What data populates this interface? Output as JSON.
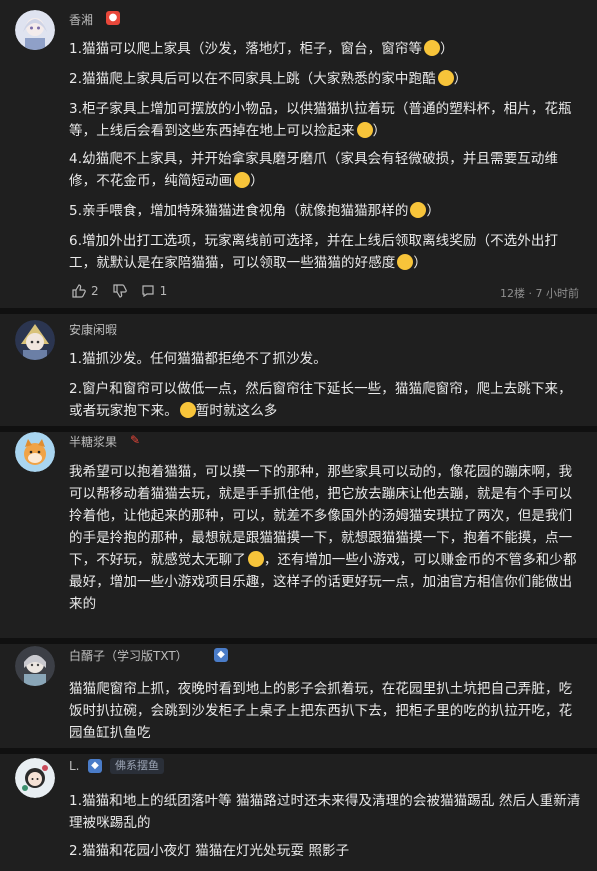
{
  "comments": [
    {
      "username": "香湘",
      "paragraphs": [
        "1.猫猫可以爬上家具（沙发，落地灯，柜子，窗台，窗帘等",
        "2.猫猫爬上家具后可以在不同家具上跳（大家熟悉的家中跑酷",
        "3.柜子家具上增加可摆放的小物品，以供猫猫扒拉着玩（普通的塑料杯，相片，花瓶等，上线后会看到这些东西掉在地上可以捡起来",
        "4.幼猫爬不上家具，并开始拿家具磨牙磨爪（家具会有轻微破损，并且需要互动维修，不花金币，纯简短动画",
        "5.亲手喂食，增加特殊猫猫进食视角（就像抱猫猫那样的",
        "6.增加外出打工选项，玩家离线前可选择，并在上线后领取离线奖励（不选外出打工，就默认是在家陪猫猫，可以领取一些猫猫的好感度"
      ],
      "paragraph_suffix": [
        "）",
        "）",
        "）",
        "）",
        "）",
        "）"
      ],
      "likes": "2",
      "replies": "1",
      "floor_time": "12楼 · 7 小时前"
    },
    {
      "username": "安康闲暇",
      "paragraphs": [
        "1.猫抓沙发。任何猫猫都拒绝不了抓沙发。",
        "2.窗户和窗帘可以做低一点，然后窗帘往下延长一些，猫猫爬窗帘，爬上去跳下来，或者玩家抱下来。",
        "暂时就这么多"
      ]
    },
    {
      "username": "半糖浆果",
      "paragraphs": [
        "我希望可以抱着猫猫，可以摸一下的那种，那些家具可以动的，像花园的蹦床啊，我可以帮移动着猫猫去玩，就是手手抓住他，把它放去蹦床让他去蹦，就是有个手可以拎着他，让他起来的那种，可以，就差不多像国外的汤姆猫安琪拉了两次，但是我们的手是拎抱的那种，最想就是跟猫猫摸一下，就想跟猫猫摸一下，抱着不能摸，点一下，不好玩，就感觉太无聊了",
        "，还有增加一些小游戏，可以赚金币的不管多和少都最好，增加一些小游戏项目乐趣，这样子的话更好玩一点，加油官方相信你们能做出来的"
      ]
    },
    {
      "username": "白醑子（学习版TXT）",
      "paragraphs": [
        "猫猫爬窗帘上抓，夜晚时看到地上的影子会抓着玩，在花园里扒土坑把自己弄脏，吃饭时扒拉碗，会跳到沙发柜子上桌子上把东西扒下去，把柜子里的吃的扒拉开吃，花园鱼缸扒鱼吃"
      ]
    },
    {
      "username": "L.",
      "tag": "佛系摆鱼",
      "paragraphs": [
        "1.猫猫和地上的纸团落叶等 猫猫路过时还未来得及清理的会被猫猫踢乱 然后人重新清理被咪踢乱的",
        "2.猫猫和花园小夜灯 猫猫在灯光处玩耍 照影子"
      ]
    }
  ],
  "colors": {
    "background": "#161616",
    "card": "#1f1f1f",
    "text": "#e9e9e9",
    "badge_red": "#e8473a",
    "badge_blue": "#4a7cc8"
  },
  "icons": [
    "thumbs-up-icon",
    "thumbs-down-icon",
    "comment-icon",
    "emoji-icon",
    "level-badge-icon"
  ]
}
